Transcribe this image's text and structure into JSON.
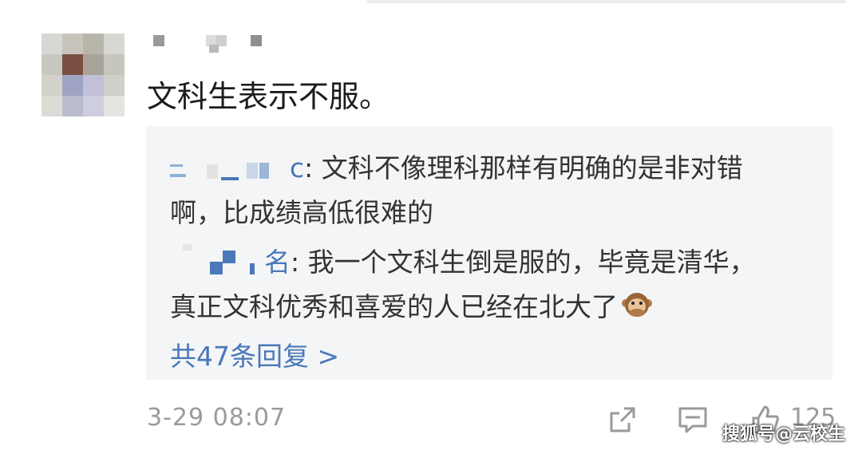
{
  "comment": {
    "text": "文科生表示不服。"
  },
  "replies": [
    {
      "name_suffix": "c",
      "text_line1": ": 文科不像理科那样有明确的是非对错",
      "text_line2": "啊，比成绩高低很难的"
    },
    {
      "name_suffix": "名",
      "text_line1": ": 我一个文科生倒是服的，毕竟是清华，",
      "text_line2": "真正文科优秀和喜爱的人已经在北大了"
    }
  ],
  "more_replies": "共47条回复 >",
  "meta": {
    "time": "3-29 08:07",
    "likes": "125"
  },
  "watermark": "搜狐号@云校生",
  "icons": [
    "share-icon",
    "comment-icon",
    "like-icon",
    "monkey-emoji-icon"
  ],
  "colors": {
    "link": "#4a78b8",
    "meta": "#9a9a9a",
    "reply_bg": "#f4f5f7"
  }
}
